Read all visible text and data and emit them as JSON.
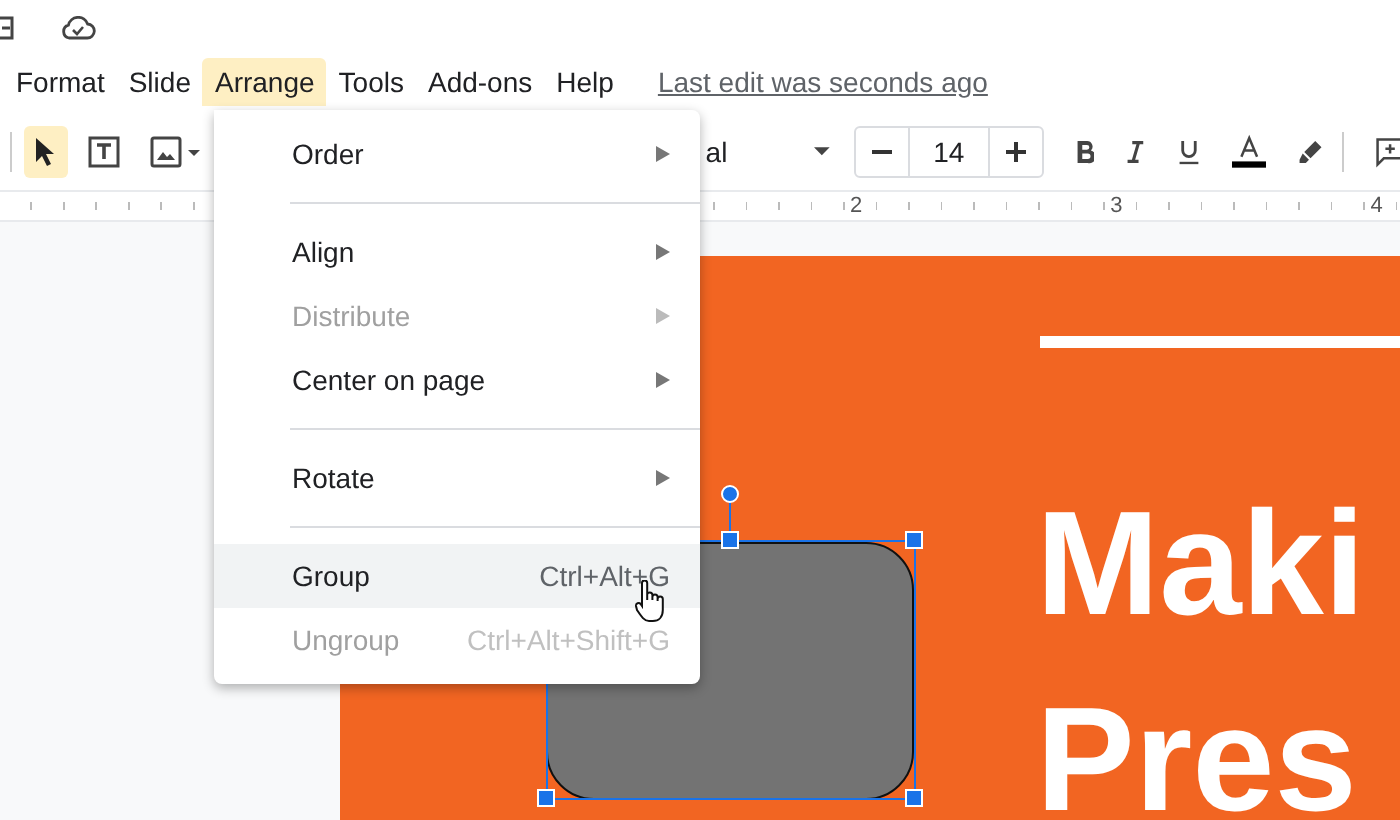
{
  "menu_bar": [
    {
      "label": "Format",
      "selected": false
    },
    {
      "label": "Slide",
      "selected": false
    },
    {
      "label": "Arrange",
      "selected": true
    },
    {
      "label": "Tools",
      "selected": false
    },
    {
      "label": "Add-ons",
      "selected": false
    },
    {
      "label": "Help",
      "selected": false
    }
  ],
  "last_edit": "Last edit was seconds ago",
  "toolbar": {
    "tools": [
      {
        "kind": "select",
        "selected": true
      },
      {
        "kind": "textbox",
        "selected": false
      },
      {
        "kind": "image",
        "selected": false
      }
    ],
    "font": "al",
    "font_size": "14"
  },
  "ruler": {
    "labels": [
      "2",
      "3",
      "4"
    ]
  },
  "arrange_menu": [
    {
      "kind": "item",
      "label": "Order",
      "submenu": true,
      "disabled": false,
      "selected": false
    },
    {
      "kind": "separator"
    },
    {
      "kind": "item",
      "label": "Align",
      "submenu": true,
      "disabled": false,
      "selected": false
    },
    {
      "kind": "item",
      "label": "Distribute",
      "submenu": true,
      "disabled": true,
      "selected": false
    },
    {
      "kind": "item",
      "label": "Center on page",
      "submenu": true,
      "disabled": false,
      "selected": false
    },
    {
      "kind": "separator"
    },
    {
      "kind": "item",
      "label": "Rotate",
      "submenu": true,
      "disabled": false,
      "selected": false
    },
    {
      "kind": "separator"
    },
    {
      "kind": "item",
      "label": "Group",
      "shortcut": "Ctrl+Alt+G",
      "submenu": false,
      "disabled": false,
      "selected": true
    },
    {
      "kind": "item",
      "label": "Ungroup",
      "shortcut": "Ctrl+Alt+Shift+G",
      "submenu": false,
      "disabled": true,
      "selected": false
    }
  ],
  "slide": {
    "title_lines": [
      "Maki",
      "Pres"
    ],
    "shape": {
      "selected": true
    }
  }
}
